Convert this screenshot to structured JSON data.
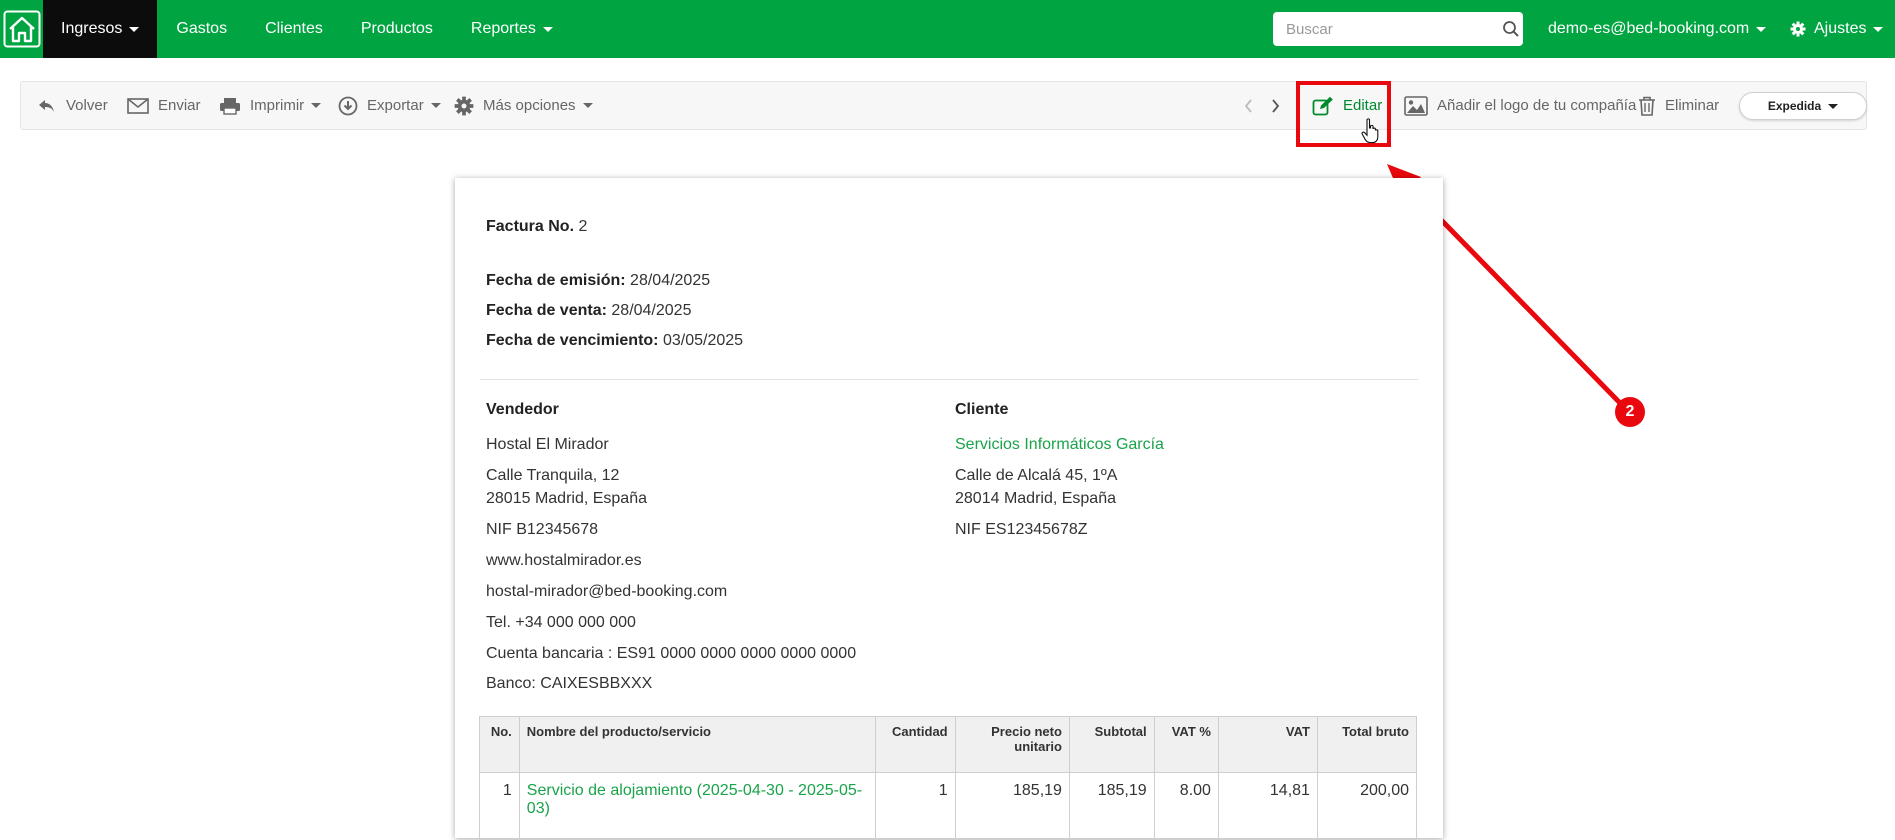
{
  "nav": {
    "items": [
      {
        "label": "Ingresos",
        "active": true,
        "has_dropdown": true
      },
      {
        "label": "Gastos",
        "active": false,
        "has_dropdown": false
      },
      {
        "label": "Clientes",
        "active": false,
        "has_dropdown": false
      },
      {
        "label": "Productos",
        "active": false,
        "has_dropdown": false
      },
      {
        "label": "Reportes",
        "active": false,
        "has_dropdown": true
      }
    ],
    "search_placeholder": "Buscar",
    "user_email": "demo-es@bed-booking.com",
    "settings_label": "Ajustes",
    "brand_color": "#00a542"
  },
  "toolbar": {
    "back": "Volver",
    "send": "Enviar",
    "print": "Imprimir",
    "export": "Exportar",
    "more": "Más opciones",
    "edit": "Editar",
    "add_logo": "Añadir el logo de tu compañía",
    "delete": "Eliminar",
    "status": "Expedida"
  },
  "annotation": {
    "marker_number": "2",
    "color": "#e8080d"
  },
  "invoice": {
    "number_label": "Factura No.",
    "number": "2",
    "issue_date_label": "Fecha de emisión:",
    "issue_date": "28/04/2025",
    "sale_date_label": "Fecha de venta:",
    "sale_date": "28/04/2025",
    "due_date_label": "Fecha de vencimiento:",
    "due_date": "03/05/2025",
    "seller": {
      "heading": "Vendedor",
      "name": "Hostal El Mirador",
      "address1": "Calle Tranquila, 12",
      "address2": "28015 Madrid, España",
      "nif": "NIF B12345678",
      "website": "www.hostalmirador.es",
      "email": "hostal-mirador@bed-booking.com",
      "phone": "Tel. +34 000 000 000",
      "bank_account": "Cuenta bancaria : ES91 0000 0000 0000 0000 0000",
      "bank": "Banco: CAIXESBBXXX"
    },
    "client": {
      "heading": "Cliente",
      "name": "Servicios Informáticos García",
      "address1": "Calle de Alcalá 45, 1ºA",
      "address2": "28014 Madrid, España",
      "nif": "NIF ES12345678Z"
    },
    "table": {
      "headers": [
        "No.",
        "Nombre del producto/servicio",
        "Cantidad",
        "Precio neto unitario",
        "Subtotal",
        "VAT %",
        "VAT",
        "Total bruto"
      ],
      "rows": [
        {
          "no": "1",
          "name": "Servicio de alojamiento (2025-04-30 - 2025-05-03)",
          "qty": "1",
          "unit_price": "185,19",
          "subtotal": "185,19",
          "vat_pct": "8.00",
          "vat": "14,81",
          "total": "200,00"
        }
      ]
    }
  }
}
